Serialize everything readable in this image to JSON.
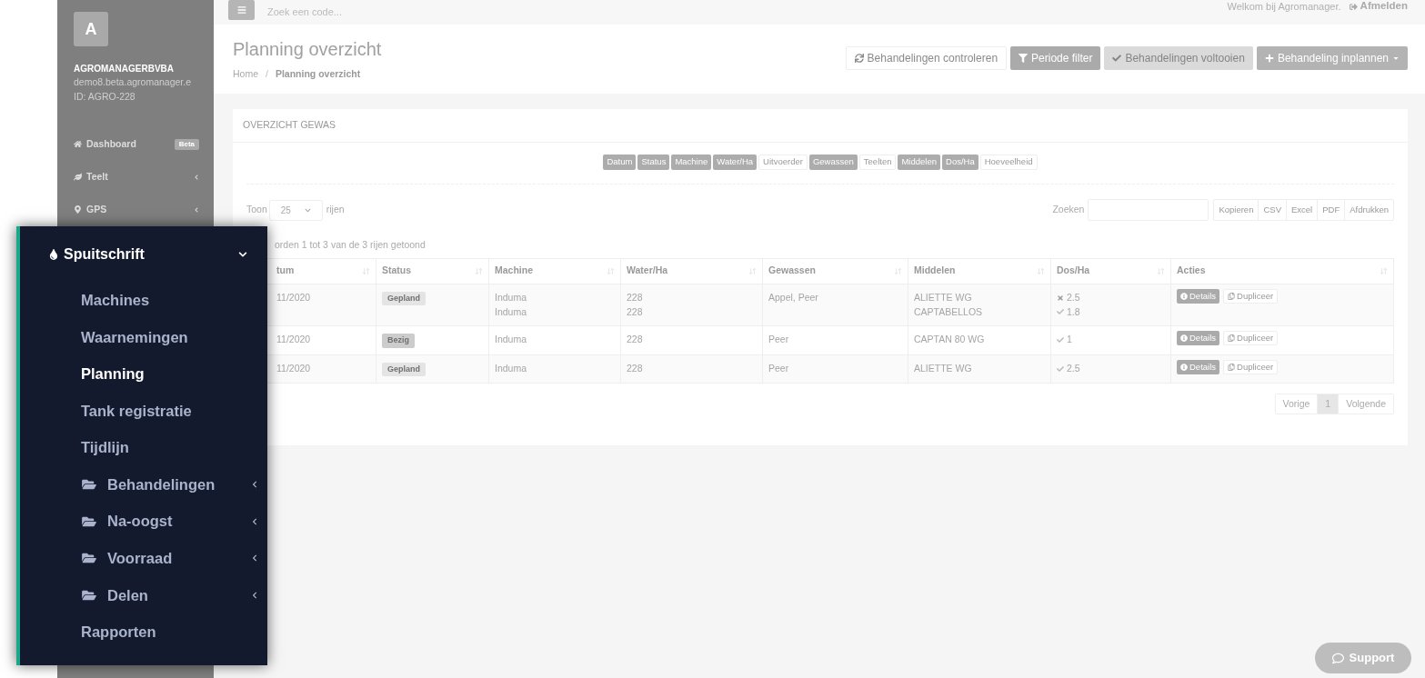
{
  "topbar": {
    "search": {
      "placeholder": "Zoek een code..."
    },
    "welcome": "Welkom bij Agromanager.",
    "logout": "Afmelden"
  },
  "sidebar": {
    "avatar": "A",
    "company": "AGROMANAGERBVBA",
    "email": "demo8.beta.agromanager.e",
    "account_id": "ID: AGRO-228",
    "items": [
      {
        "label": "Dashboard",
        "badge": "Beta",
        "has_children": false
      },
      {
        "label": "Teelt",
        "has_children": true
      },
      {
        "label": "GPS",
        "has_children": true
      }
    ]
  },
  "page": {
    "title": "Planning overzicht",
    "breadcrumb_separator": "/",
    "breadcrumb": [
      {
        "label": "Home",
        "current": false
      },
      {
        "label": "Planning overzicht",
        "current": true
      }
    ],
    "actions": [
      {
        "label": "Behandelingen controleren",
        "kind": "default"
      },
      {
        "label": "Periode filter",
        "kind": "primary"
      },
      {
        "label": "Behandelingen voltooien",
        "kind": "disabled"
      },
      {
        "label": "Behandeling inplannen",
        "kind": "dropdown"
      }
    ]
  },
  "card": {
    "title": "OVERZICHT GEWAS",
    "column_toggles": [
      {
        "label": "Datum",
        "selected": true
      },
      {
        "label": "Status",
        "selected": true
      },
      {
        "label": "Machine",
        "selected": true
      },
      {
        "label": "Water/Ha",
        "selected": true
      },
      {
        "label": "Uitvoerder",
        "selected": false
      },
      {
        "label": "Gewassen",
        "selected": true
      },
      {
        "label": "Teelten",
        "selected": false
      },
      {
        "label": "Middelen",
        "selected": true
      },
      {
        "label": "Dos/Ha",
        "selected": true
      },
      {
        "label": "Hoeveelheid",
        "selected": false
      }
    ],
    "length": {
      "before": "Toon",
      "value": "25",
      "after": "rijen"
    },
    "search_label": "Zoeken",
    "export_buttons": [
      "Kopieren",
      "CSV",
      "Excel",
      "PDF",
      "Afdrukken"
    ],
    "info": "orden 1 tot 3 van de 3 rijen getoond",
    "table": {
      "columns": [
        "tum",
        "Status",
        "Machine",
        "Water/Ha",
        "Gewassen",
        "Middelen",
        "Dos/Ha",
        "Acties"
      ],
      "rows": [
        {
          "date": "11/2020",
          "status": {
            "label": "Gepland",
            "color": "#e4e4e4"
          },
          "machine": [
            "Induma",
            "Induma"
          ],
          "water": [
            "228",
            "228"
          ],
          "crops": "Appel, Peer",
          "products": [
            "ALIETTE WG",
            "CAPTABELLOS"
          ],
          "doses": [
            {
              "kind": "cross",
              "value": "2.5"
            },
            {
              "kind": "check",
              "value": "1.8"
            }
          ],
          "actions": [
            "Details",
            "Dupliceer"
          ]
        },
        {
          "date": "11/2020",
          "status": {
            "label": "Bezig",
            "color": "#cccccc"
          },
          "machine": [
            "Induma"
          ],
          "water": [
            "228"
          ],
          "crops": "Peer",
          "products": [
            "CAPTAN 80 WG"
          ],
          "doses": [
            {
              "kind": "check",
              "value": "1"
            }
          ],
          "actions": [
            "Details",
            "Dupliceer"
          ]
        },
        {
          "date": "11/2020",
          "status": {
            "label": "Gepland",
            "color": "#e4e4e4"
          },
          "machine": [
            "Induma"
          ],
          "water": [
            "228"
          ],
          "crops": "Peer",
          "products": [
            "ALIETTE WG"
          ],
          "doses": [
            {
              "kind": "check",
              "value": "2.5"
            }
          ],
          "actions": [
            "Details",
            "Dupliceer"
          ]
        }
      ]
    },
    "pagination": [
      {
        "label": "Vorige",
        "selected": false
      },
      {
        "label": "1",
        "selected": true
      },
      {
        "label": "Volgende",
        "selected": false
      }
    ]
  },
  "menu_popup": {
    "title": "Spuitschrift",
    "expanded": true,
    "items": [
      {
        "label": "Machines",
        "kind": "link",
        "selected": false
      },
      {
        "label": "Waarnemingen",
        "kind": "link",
        "selected": false
      },
      {
        "label": "Planning",
        "kind": "link",
        "selected": true
      },
      {
        "label": "Tank registratie",
        "kind": "link",
        "selected": false
      },
      {
        "label": "Tijdlijn",
        "kind": "link",
        "selected": false
      },
      {
        "label": "Behandelingen",
        "kind": "folder",
        "selected": false
      },
      {
        "label": "Na-oogst",
        "kind": "folder",
        "selected": false
      },
      {
        "label": "Voorraad",
        "kind": "folder",
        "selected": false
      },
      {
        "label": "Delen",
        "kind": "folder",
        "selected": false
      },
      {
        "label": "Rapporten",
        "kind": "link",
        "selected": false
      }
    ]
  },
  "support": "Support"
}
